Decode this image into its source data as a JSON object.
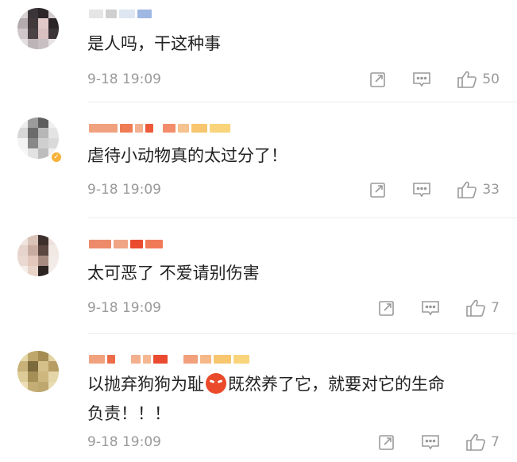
{
  "comments": [
    {
      "text": "是人吗，干这种事",
      "time": "9-18 19:09",
      "likes": "50"
    },
    {
      "text": "虐待小动物真的太过分了！",
      "time": "9-18 19:09",
      "likes": "33"
    },
    {
      "text": "太可恶了 不爱请别伤害",
      "time": "9-18 19:09",
      "likes": "7"
    },
    {
      "text_part1": "以抛弃狗狗为耻",
      "text_part2": "既然养了它，就要对它的生命",
      "text_line2": "负责！！！",
      "time": "9-18 19:09",
      "likes": "7"
    }
  ],
  "icons": {
    "share": "share-icon",
    "comment": "comment-icon",
    "like": "thumbs-up-icon",
    "verified": "verified-badge-icon",
    "emoji": "angry-face-emoji"
  }
}
